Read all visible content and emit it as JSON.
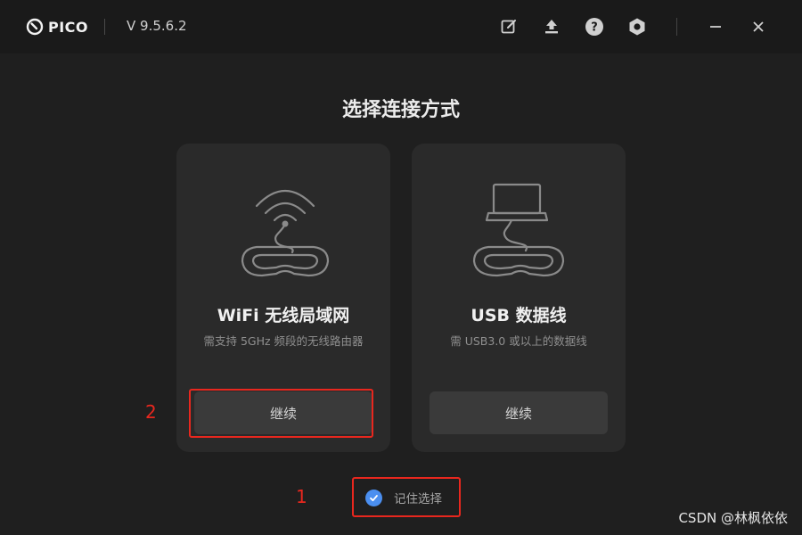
{
  "app": {
    "brand": "PICO",
    "version": "V 9.5.6.2"
  },
  "titlebar": {
    "icons": [
      "edit-icon",
      "upload-icon",
      "help-icon",
      "settings-icon",
      "minimize-icon",
      "close-icon"
    ]
  },
  "main": {
    "heading": "选择连接方式",
    "cards": [
      {
        "title": "WiFi 无线局域网",
        "description": "需支持 5GHz 频段的无线路由器",
        "button_label": "继续",
        "icon": "wifi-headset-illustration"
      },
      {
        "title": "USB 数据线",
        "description": "需 USB3.0 或以上的数据线",
        "button_label": "继续",
        "icon": "laptop-headset-illustration"
      }
    ],
    "remember": {
      "label": "记住选择",
      "checked": true
    }
  },
  "annotations": {
    "label_1": "1",
    "label_2": "2",
    "color": "#e8271e"
  },
  "watermark": "CSDN @林枫依依",
  "colors": {
    "accent": "#4b8ff0",
    "background": "#1f1f1f",
    "card": "#2a2a2a",
    "button": "#3a3a3a"
  }
}
